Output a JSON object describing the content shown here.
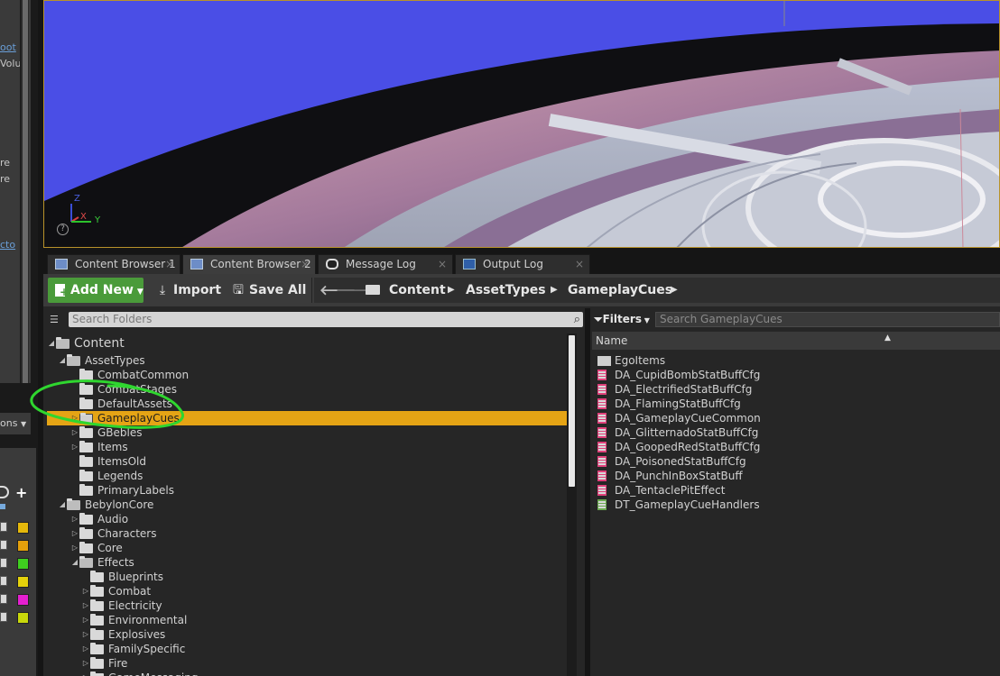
{
  "left_panel": {
    "snippets": [
      "oot",
      "Volu",
      "re",
      "re",
      "cto"
    ],
    "options_label": "ons",
    "swatch_colors": [
      "#e5b80b",
      "#e5a00b",
      "#3fcf1f",
      "#e5d20b",
      "#e51fd0",
      "#c8d80b"
    ]
  },
  "viewport": {
    "axis_x": "X",
    "axis_y": "Y",
    "axis_z": "Z",
    "help_icon": "question-icon",
    "sky_color": "#4a4ee6"
  },
  "tabs": [
    {
      "label": "Content Browser 1",
      "icon": "content-browser-icon",
      "close": "×"
    },
    {
      "label": "Content Browser 2",
      "icon": "content-browser-icon",
      "close": "×"
    },
    {
      "label": "Message Log",
      "icon": "message-log-icon",
      "close": "×"
    },
    {
      "label": "Output Log",
      "icon": "output-log-icon",
      "close": "×"
    }
  ],
  "toolbar": {
    "add_new": "Add New",
    "import": "Import",
    "save_all": "Save All"
  },
  "breadcrumbs": [
    "Content",
    "AssetTypes",
    "GameplayCues"
  ],
  "folder_search": {
    "placeholder": "Search Folders"
  },
  "folder_tree": [
    {
      "label": "Content"
    },
    {
      "label": "AssetTypes"
    },
    {
      "label": "CombatCommon"
    },
    {
      "label": "CombatStages"
    },
    {
      "label": "DefaultAssets"
    },
    {
      "label": "GameplayCues",
      "selected": true
    },
    {
      "label": "GBebles"
    },
    {
      "label": "Items"
    },
    {
      "label": "ItemsOld"
    },
    {
      "label": "Legends"
    },
    {
      "label": "PrimaryLabels"
    },
    {
      "label": "BebylonCore"
    },
    {
      "label": "Audio"
    },
    {
      "label": "Characters"
    },
    {
      "label": "Core"
    },
    {
      "label": "Effects"
    },
    {
      "label": "Blueprints"
    },
    {
      "label": "Combat"
    },
    {
      "label": "Electricity"
    },
    {
      "label": "Environmental"
    },
    {
      "label": "Explosives"
    },
    {
      "label": "FamilySpecific"
    },
    {
      "label": "Fire"
    },
    {
      "label": "GameMessaging"
    }
  ],
  "asset_panel": {
    "filters": "Filters",
    "search_placeholder": "Search GameplayCues",
    "column_name": "Name",
    "assets": [
      {
        "name": "EgoItems",
        "kind": "folder"
      },
      {
        "name": "DA_CupidBombStatBuffCfg",
        "kind": "data-asset"
      },
      {
        "name": "DA_ElectrifiedStatBuffCfg",
        "kind": "data-asset"
      },
      {
        "name": "DA_FlamingStatBuffCfg",
        "kind": "data-asset"
      },
      {
        "name": "DA_GameplayCueCommon",
        "kind": "data-asset"
      },
      {
        "name": "DA_GlitternadoStatBuffCfg",
        "kind": "data-asset"
      },
      {
        "name": "DA_GoopedRedStatBuffCfg",
        "kind": "data-asset"
      },
      {
        "name": "DA_PoisonedStatBuffCfg",
        "kind": "data-asset"
      },
      {
        "name": "DA_PunchInBoxStatBuff",
        "kind": "data-asset"
      },
      {
        "name": "DA_TentaclePitEffect",
        "kind": "data-asset"
      },
      {
        "name": "DT_GameplayCueHandlers",
        "kind": "data-table"
      }
    ]
  },
  "colors": {
    "selection": "#e5a415",
    "add_new_bg": "#4a9b3a",
    "annotation_circle": "#2fd62f",
    "viewport_border": "#b8922a"
  }
}
